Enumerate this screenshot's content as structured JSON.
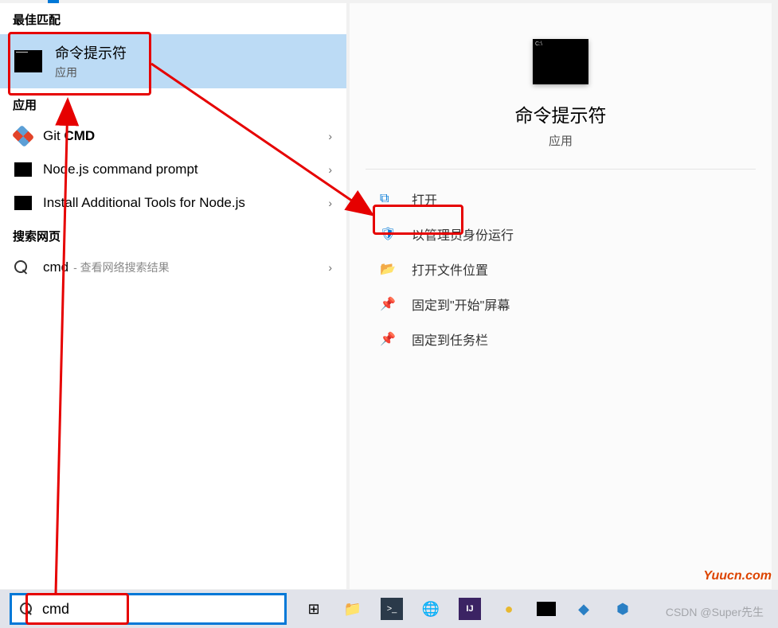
{
  "headers": {
    "best_match": "最佳匹配",
    "apps": "应用",
    "web": "搜索网页"
  },
  "best_match": {
    "title": "命令提示符",
    "subtitle": "应用"
  },
  "apps": [
    {
      "label_html": "Git CMD",
      "icon": "git"
    },
    {
      "label_html": "Node.js command prompt",
      "icon": "black"
    },
    {
      "label_html": "Install Additional Tools for Node.js",
      "icon": "black"
    }
  ],
  "web": {
    "query": "cmd",
    "hint": "- 查看网络搜索结果"
  },
  "detail": {
    "title": "命令提示符",
    "subtitle": "应用",
    "actions": {
      "open": "打开",
      "run_admin": "以管理员身份运行",
      "file_loc": "打开文件位置",
      "pin_start": "固定到\"开始\"屏幕",
      "pin_taskbar": "固定到任务栏"
    }
  },
  "search_input": {
    "value": "cmd",
    "placeholder": ""
  },
  "watermarks": {
    "site": "Yuucn.com",
    "author": "CSDN @Super先生"
  }
}
